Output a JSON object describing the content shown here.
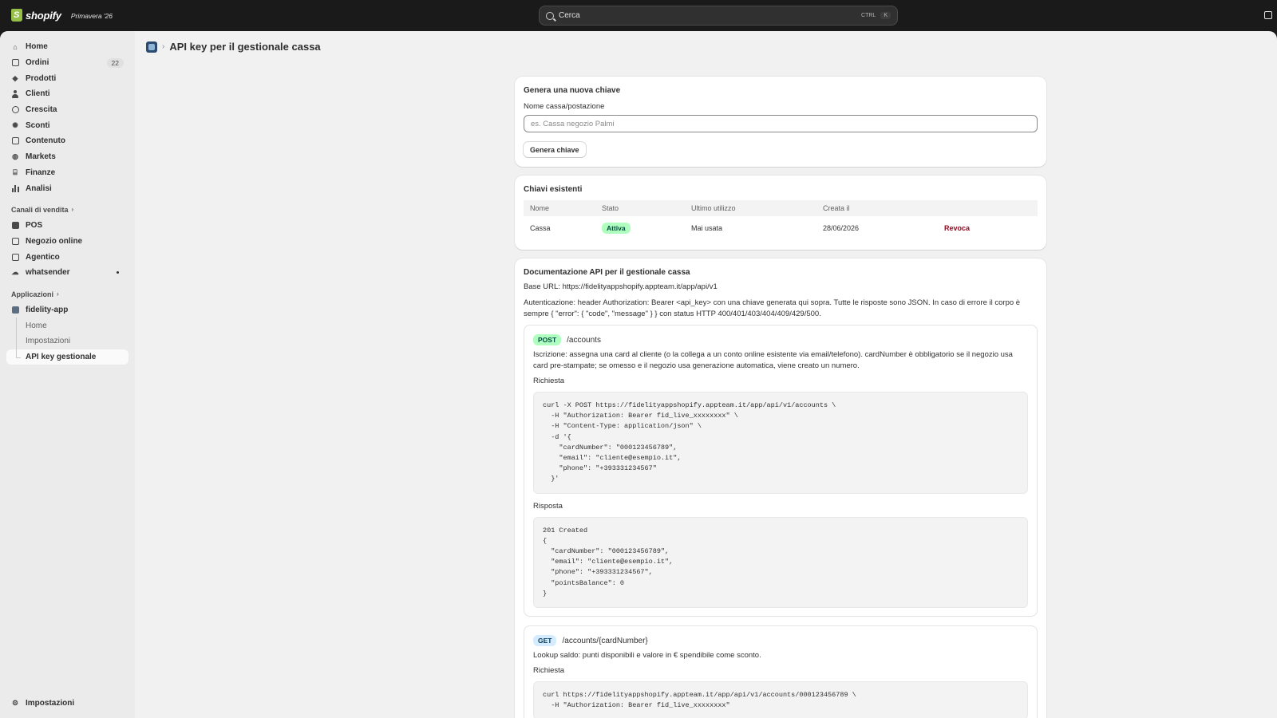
{
  "topbar": {
    "logo_text": "shopify",
    "edition": "Primavera '26",
    "search_placeholder": "Cerca",
    "shortcut_mod": "CTRL",
    "shortcut_key": "K"
  },
  "sidebar": {
    "items": [
      {
        "label": "Home",
        "icon": "home-icon"
      },
      {
        "label": "Ordini",
        "icon": "orders-icon",
        "badge": "22"
      },
      {
        "label": "Prodotti",
        "icon": "tag-icon"
      },
      {
        "label": "Clienti",
        "icon": "person-icon"
      },
      {
        "label": "Crescita",
        "icon": "gauge-icon"
      },
      {
        "label": "Sconti",
        "icon": "discount-icon"
      },
      {
        "label": "Contenuto",
        "icon": "content-icon"
      },
      {
        "label": "Markets",
        "icon": "globe-icon"
      },
      {
        "label": "Finanze",
        "icon": "bank-icon"
      },
      {
        "label": "Analisi",
        "icon": "bar-chart-icon"
      }
    ],
    "sales_channels_heading": "Canali di vendita",
    "channels": [
      {
        "label": "POS"
      },
      {
        "label": "Negozio online"
      },
      {
        "label": "Agentico"
      },
      {
        "label": "whatsender"
      }
    ],
    "apps_heading": "Applicazioni",
    "app_name": "fidelity-app",
    "app_subitems": [
      "Home",
      "Impostazioni",
      "API key gestionale"
    ],
    "settings_label": "Impostazioni"
  },
  "page": {
    "title": "API key per il gestionale cassa"
  },
  "new_key": {
    "title": "Genera una nuova chiave",
    "field_label": "Nome cassa/postazione",
    "placeholder": "es. Cassa negozio Palmi",
    "button": "Genera chiave"
  },
  "keys": {
    "title": "Chiavi esistenti",
    "columns": [
      "Nome",
      "Stato",
      "Ultimo utilizzo",
      "Creata il",
      ""
    ],
    "rows": [
      {
        "name": "Cassa",
        "status": "Attiva",
        "last_used": "Mai usata",
        "created": "28/06/2026",
        "action": "Revoca"
      }
    ]
  },
  "docs": {
    "title": "Documentazione API per il gestionale cassa",
    "base_url": "Base URL: https://fidelityappshopify.appteam.it/app/api/v1",
    "auth": "Autenticazione: header Authorization: Bearer <api_key> con una chiave generata qui sopra. Tutte le risposte sono JSON. In caso di errore il corpo è sempre { \"error\": { \"code\", \"message\" } } con status HTTP 400/401/403/404/409/429/500.",
    "endpoints": [
      {
        "method": "POST",
        "path": "/accounts",
        "description": "Iscrizione: assegna una card al cliente (o la collega a un conto online esistente via email/telefono). cardNumber è obbligatorio se il negozio usa card pre-stampate; se omesso e il negozio usa generazione automatica, viene creato un numero.",
        "request_label": "Richiesta",
        "request": "curl -X POST https://fidelityappshopify.appteam.it/app/api/v1/accounts \\\n  -H \"Authorization: Bearer fid_live_xxxxxxxx\" \\\n  -H \"Content-Type: application/json\" \\\n  -d '{\n    \"cardNumber\": \"000123456789\",\n    \"email\": \"cliente@esempio.it\",\n    \"phone\": \"+393331234567\"\n  }'",
        "response_label": "Risposta",
        "response": "201 Created\n{\n  \"cardNumber\": \"000123456789\",\n  \"email\": \"cliente@esempio.it\",\n  \"phone\": \"+393331234567\",\n  \"pointsBalance\": 0\n}"
      },
      {
        "method": "GET",
        "path": "/accounts/{cardNumber}",
        "description": "Lookup saldo: punti disponibili e valore in € spendibile come sconto.",
        "request_label": "Richiesta",
        "request": "curl https://fidelityappshopify.appteam.it/app/api/v1/accounts/000123456789 \\\n  -H \"Authorization: Bearer fid_live_xxxxxxxx\""
      }
    ]
  },
  "colors": {
    "topbar": "#1a1a1a",
    "sidebar": "#ebebeb",
    "success_badge": "#affebf",
    "info_badge": "#d5ebff",
    "critical_text": "#8e0b21"
  }
}
